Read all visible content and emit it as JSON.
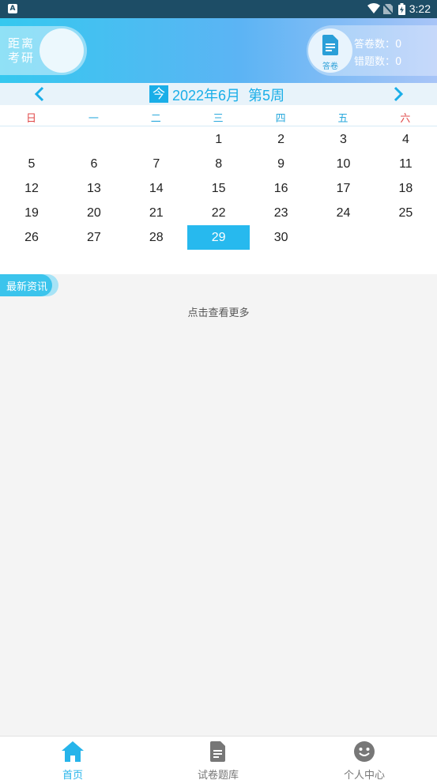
{
  "status_bar": {
    "app_badge": "A",
    "time": "3:22"
  },
  "header": {
    "countdown_label": "距离考研",
    "answer_sheet_label": "答卷",
    "answered_count_label": "答卷数：0",
    "wrong_count_label": "错题数：0"
  },
  "calendar": {
    "today_label": "今",
    "title": "2022年6月  第5周",
    "weekdays": [
      "日",
      "一",
      "二",
      "三",
      "四",
      "五",
      "六"
    ],
    "selected_day": "29",
    "weeks": [
      [
        "",
        "",
        "",
        "1",
        "2",
        "3",
        "4"
      ],
      [
        "5",
        "6",
        "7",
        "8",
        "9",
        "10",
        "11"
      ],
      [
        "12",
        "13",
        "14",
        "15",
        "16",
        "17",
        "18"
      ],
      [
        "19",
        "20",
        "21",
        "22",
        "23",
        "24",
        "25"
      ],
      [
        "26",
        "27",
        "28",
        "29",
        "30",
        "",
        ""
      ]
    ]
  },
  "news": {
    "section_title": "最新资讯",
    "more_link": "点击查看更多"
  },
  "bottom_nav": {
    "tabs": [
      {
        "label": "首页",
        "icon": "home-icon",
        "active": true
      },
      {
        "label": "试卷题库",
        "icon": "document-icon",
        "active": false
      },
      {
        "label": "个人中心",
        "icon": "smiley-icon",
        "active": false
      }
    ]
  },
  "colors": {
    "accent": "#1aaee8",
    "weekend": "#e04848",
    "selected": "#27b9ee"
  }
}
